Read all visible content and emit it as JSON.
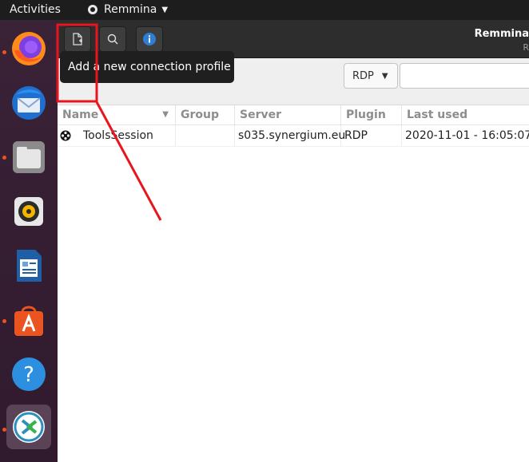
{
  "topbar": {
    "activities": "Activities",
    "app_name": "Remmina"
  },
  "dock": {
    "items": [
      {
        "icon": "firefox-icon",
        "running": true
      },
      {
        "icon": "thunderbird-icon",
        "running": false
      },
      {
        "icon": "files-icon",
        "running": true
      },
      {
        "icon": "rhythmbox-icon",
        "running": false
      },
      {
        "icon": "libreoffice-writer-icon",
        "running": false
      },
      {
        "icon": "ubuntu-software-icon",
        "running": true
      },
      {
        "icon": "help-icon",
        "running": false
      },
      {
        "icon": "remmina-icon",
        "running": true
      }
    ]
  },
  "window": {
    "title": "Remmina",
    "subtitle": "R",
    "toolbar": {
      "new_profile_icon": "new-connection-icon",
      "search_icon": "search-icon",
      "info_icon": "info-icon"
    },
    "tooltip": "Add a new connection profile",
    "protocol_select": "RDP",
    "table": {
      "columns": [
        "Name",
        "Group",
        "Server",
        "Plugin",
        "Last used"
      ],
      "rows": [
        {
          "name": "ToolsSession",
          "group": "",
          "server": "s035.synergium.eu",
          "plugin": "RDP",
          "last_used": "2020-11-01 - 16:05:07"
        }
      ]
    }
  },
  "colors": {
    "accent": "#e95420",
    "annotation": "#e8141e"
  }
}
